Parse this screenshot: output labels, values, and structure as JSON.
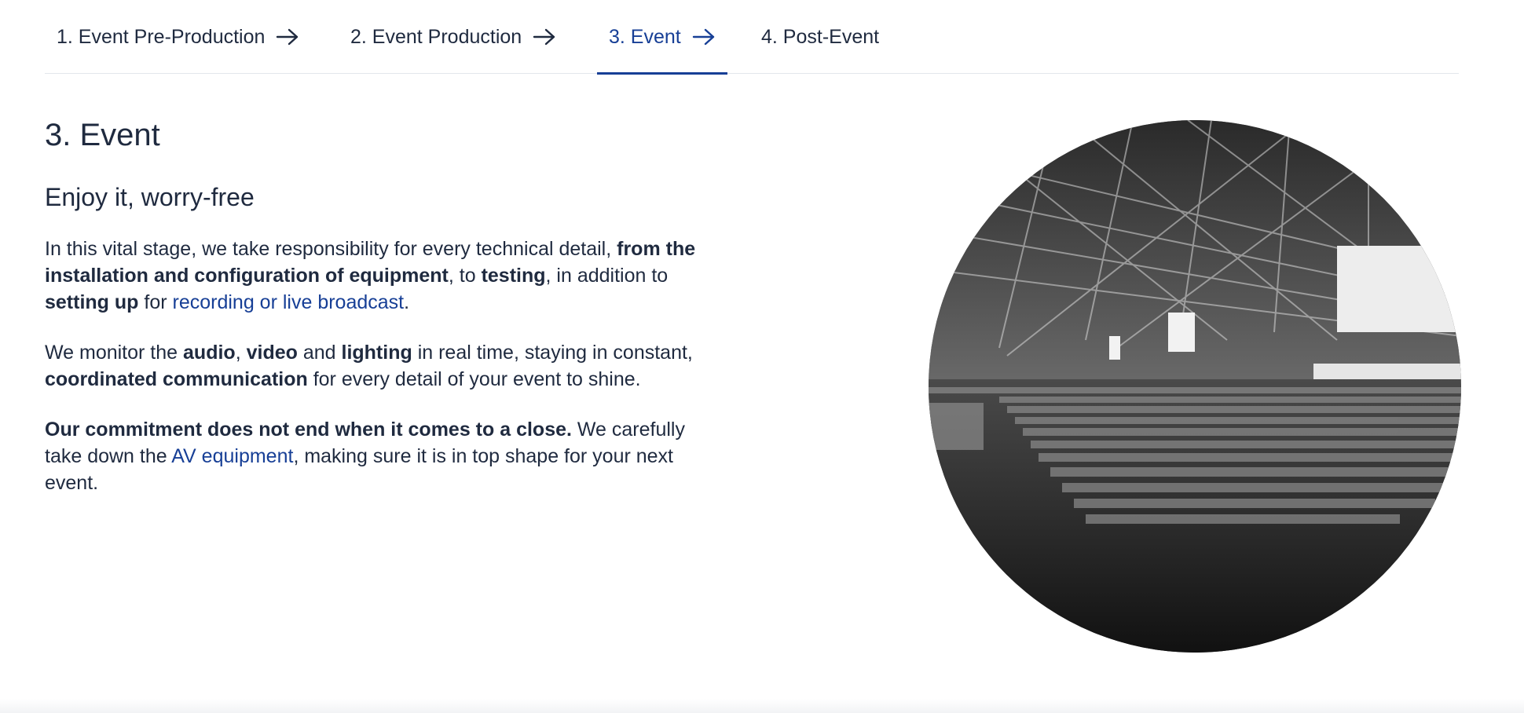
{
  "tabs": [
    {
      "label": "1. Event Pre-Production",
      "has_arrow": true
    },
    {
      "label": "2. Event Production",
      "has_arrow": true
    },
    {
      "label": "3. Event",
      "has_arrow": true,
      "active": true
    },
    {
      "label": "4. Post-Event",
      "has_arrow": false
    }
  ],
  "section": {
    "title": "3. Event",
    "subtitle": "Enjoy it, worry-free",
    "p1": {
      "t1": "In this vital stage, we take responsibility for every technical detail, ",
      "b1": "from the installation and configuration of equipment",
      "t2": ", to ",
      "b2": "testing",
      "t3": ", in addition to ",
      "b3": "setting up",
      "t4": " for ",
      "link": "recording or live broadcast",
      "t5": "."
    },
    "p2": {
      "t1": "We monitor the ",
      "b1": "audio",
      "t2": ", ",
      "b2": "video",
      "t3": " and ",
      "b3": "lighting",
      "t4": " in real time, staying in constant, ",
      "b4": "coordinated communication",
      "t5": " for every detail of your event to shine."
    },
    "p3": {
      "b1": "Our commitment does not end when it comes to a close.",
      "t1": " We carefully take down the ",
      "link": "AV equipment",
      "t2": ", making sure it is in top shape for your next event."
    }
  },
  "image": {
    "alt": "Large conference hall with audience"
  },
  "colors": {
    "accent": "#173f96",
    "text": "#1f2a3f",
    "divider": "#e3e6ec"
  },
  "icons": {
    "tab_arrow": "arrow-right-icon"
  }
}
